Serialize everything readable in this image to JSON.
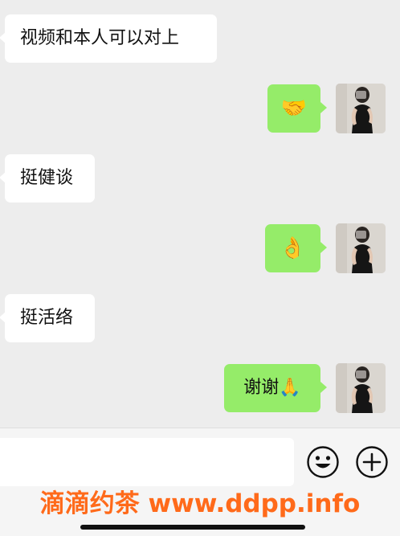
{
  "messages": [
    {
      "side": "left",
      "text": "视频和本人可以对上"
    },
    {
      "side": "right",
      "text": "🤝"
    },
    {
      "side": "left",
      "text": "挺健谈"
    },
    {
      "side": "right",
      "text": "👌"
    },
    {
      "side": "left",
      "text": "挺活络"
    },
    {
      "side": "right",
      "text": "谢谢🙏"
    }
  ],
  "input": {
    "value": "",
    "placeholder": ""
  },
  "icons": {
    "emoji_button": "smiley-face-icon",
    "more_button": "plus-circle-icon",
    "avatar": "user-avatar"
  },
  "colors": {
    "chat_background": "#ededed",
    "incoming_bubble": "#ffffff",
    "outgoing_bubble": "#95ec69",
    "input_bar": "#f5f5f5",
    "watermark": "#ff6a1a"
  },
  "watermark": "滴滴约茶 www.ddpp.info"
}
